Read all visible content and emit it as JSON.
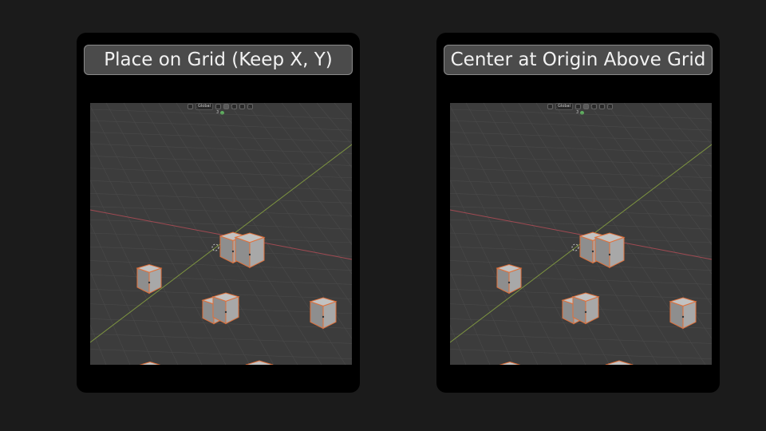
{
  "panels": [
    {
      "id": "left",
      "caption": "Place on Grid (Keep X, Y)"
    },
    {
      "id": "right",
      "caption": "Center at Origin Above Grid"
    }
  ],
  "viewport_header": {
    "orientation_label": "Global",
    "snap_count": "3"
  },
  "colors": {
    "background": "#1b1b1b",
    "panel": "#000000",
    "viewport": "#3c3c3c",
    "grid": "#4a4a4a",
    "x_axis": "#a04a52",
    "y_axis": "#7d9440",
    "cube_outline": "#e0703a",
    "cube_face_top": "#c2c2c2",
    "cube_face_left": "#8e8e8e",
    "cube_face_right": "#a8a8a8"
  },
  "scene": {
    "cube_count": 9,
    "selection_state": "all selected",
    "icons": [
      "3d-cursor-icon",
      "transform-orientation-icon",
      "pivot-icon",
      "snap-icon",
      "proportional-edit-icon"
    ]
  }
}
